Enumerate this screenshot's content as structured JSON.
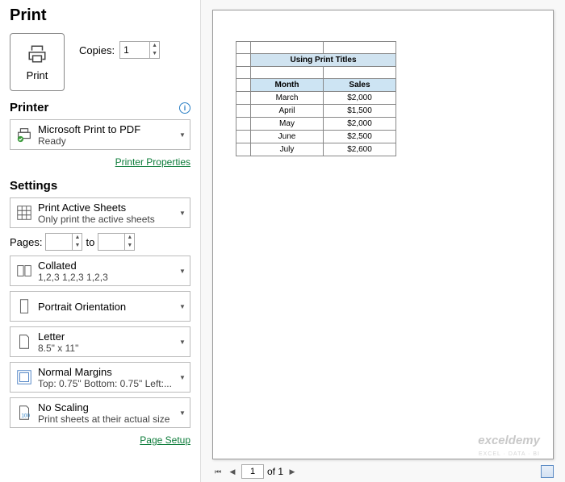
{
  "title": "Print",
  "printButton": {
    "label": "Print"
  },
  "copies": {
    "label": "Copies:",
    "value": "1"
  },
  "printer": {
    "heading": "Printer",
    "name": "Microsoft Print to PDF",
    "status": "Ready",
    "propertiesLink": "Printer Properties"
  },
  "settings": {
    "heading": "Settings",
    "printWhat": {
      "main": "Print Active Sheets",
      "sub": "Only print the active sheets"
    },
    "pages": {
      "label": "Pages:",
      "from": "",
      "toLabel": "to",
      "to": ""
    },
    "collate": {
      "main": "Collated",
      "sub": "1,2,3    1,2,3    1,2,3"
    },
    "orientation": {
      "main": "Portrait Orientation"
    },
    "paper": {
      "main": "Letter",
      "sub": "8.5\" x 11\""
    },
    "margins": {
      "main": "Normal Margins",
      "sub": "Top: 0.75\" Bottom: 0.75\" Left:..."
    },
    "scaling": {
      "main": "No Scaling",
      "sub": "Print sheets at their actual size"
    },
    "pageSetupLink": "Page Setup"
  },
  "preview": {
    "tableTitle": "Using Print Titles",
    "col1": "Month",
    "col2": "Sales",
    "rows": [
      {
        "month": "March",
        "sales": "$2,000"
      },
      {
        "month": "April",
        "sales": "$1,500"
      },
      {
        "month": "May",
        "sales": "$2,000"
      },
      {
        "month": "June",
        "sales": "$2,500"
      },
      {
        "month": "July",
        "sales": "$2,600"
      }
    ],
    "watermark": "exceldemy",
    "watermarkSub": "EXCEL · DATA · BI"
  },
  "pager": {
    "current": "1",
    "ofLabel": "of 1"
  }
}
